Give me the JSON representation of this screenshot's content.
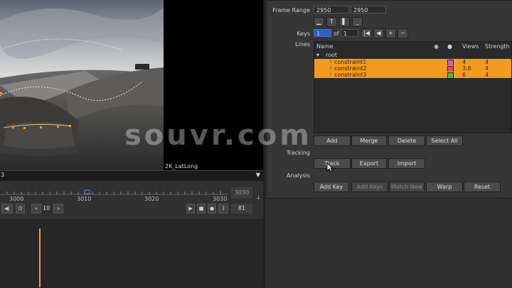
{
  "viewer": {
    "format_label": "2K_LatLong",
    "channel_label": "3",
    "dropdown_icon": "triangle-down-icon"
  },
  "timeline": {
    "ticks": [
      "3000",
      "3010",
      "3020",
      "3030"
    ],
    "end_frame": "3030",
    "playback_increment": "10",
    "current_frame": "81"
  },
  "props": {
    "frame_range_label": "Frame Range",
    "frame_start": "2950",
    "frame_end": "2950",
    "keys_label": "Keys",
    "keys_value": "1",
    "keys_of": "of",
    "keys_total": "1",
    "lines_label": "Lines",
    "table": {
      "col_name": "Name",
      "col_views": "Views",
      "col_strength": "Strength",
      "root_label": "root",
      "rows": [
        {
          "name": "constraint1",
          "views": "4",
          "strength": "4",
          "color": "#d060c0"
        },
        {
          "name": "constraint2",
          "views": "3,6",
          "strength": "4",
          "color": "#e05050"
        },
        {
          "name": "constraint3",
          "views": "6",
          "strength": "4",
          "color": "#40c040"
        }
      ]
    },
    "line_buttons": {
      "add": "Add",
      "merge": "Merge",
      "delete": "Delete",
      "select_all": "Select All"
    },
    "tracking_label": "Tracking",
    "tracking_buttons": {
      "track": "Track",
      "export": "Export",
      "import": "Import"
    },
    "analysis_label": "Analysis",
    "analysis_buttons": {
      "add_key": "Add Key",
      "add_keys": "Add Keys",
      "match_new": "Match New",
      "warp": "Warp",
      "reset": "Reset"
    }
  },
  "watermark": "souvr.com"
}
